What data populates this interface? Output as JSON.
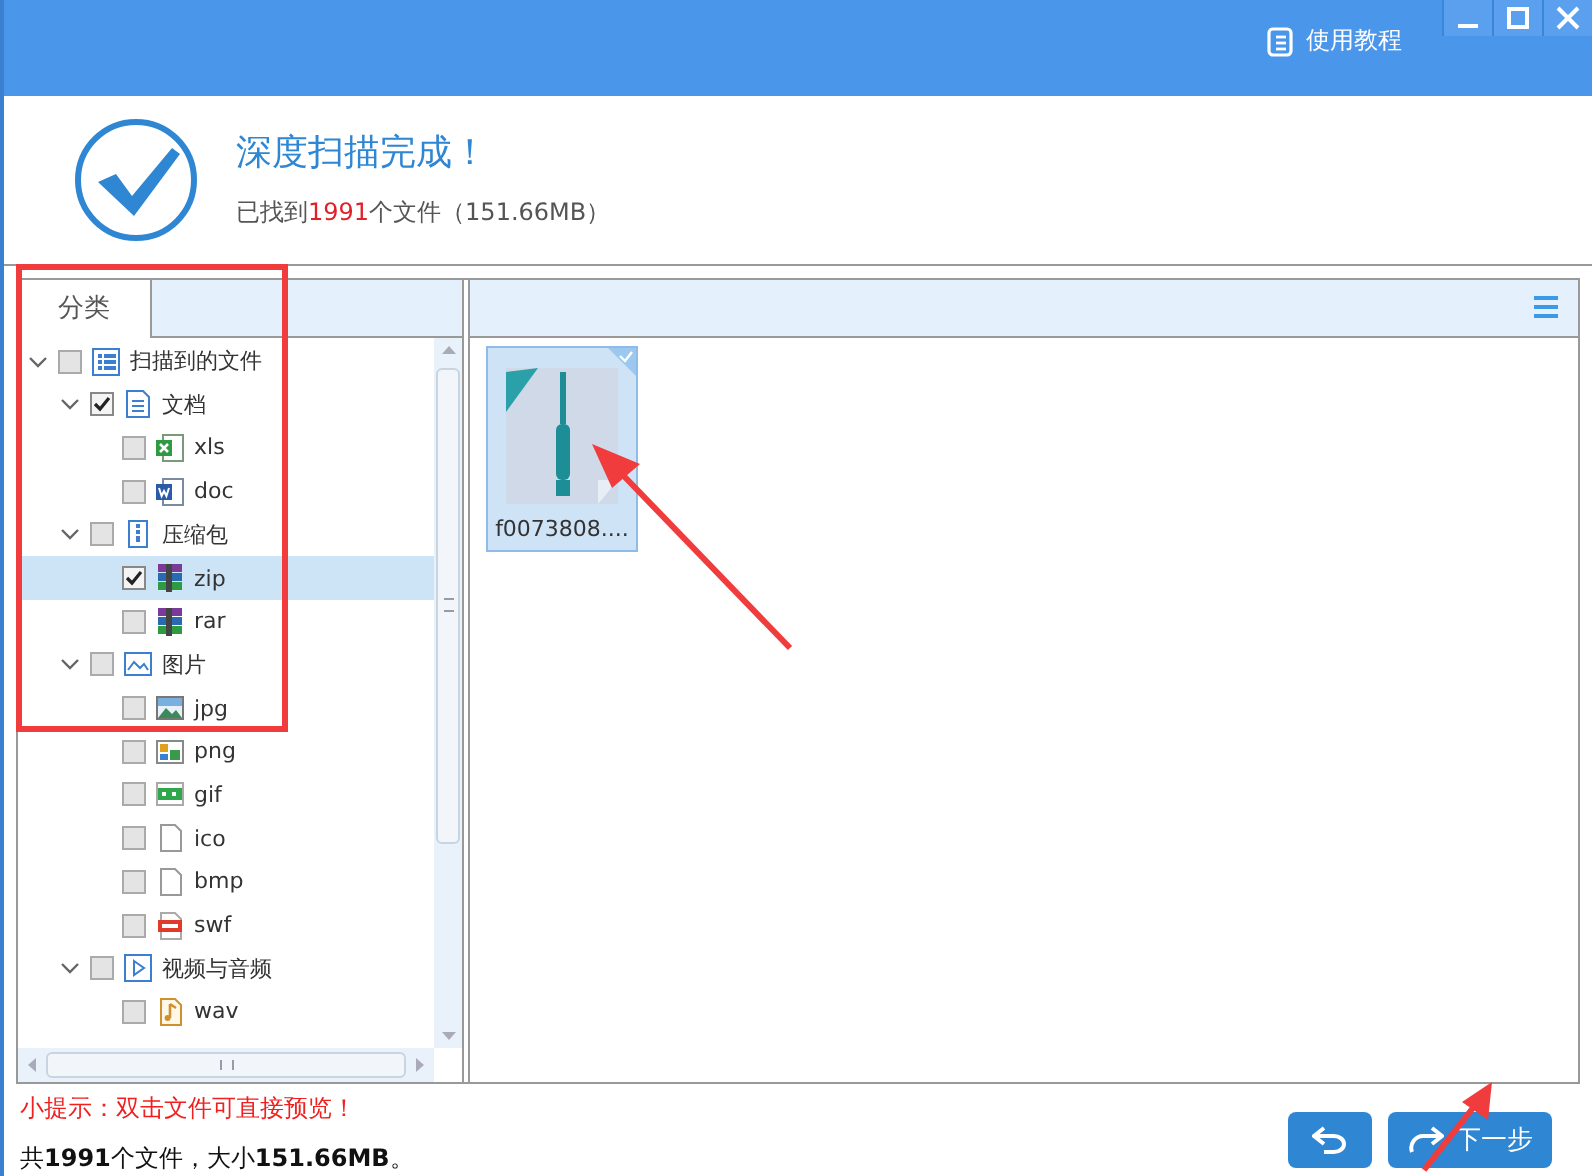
{
  "title_bar": {
    "help_button": "使用教程"
  },
  "scan_result": {
    "title": "深度扫描完成！",
    "summary_prefix": "已找到",
    "count": "1991",
    "summary_suffix": "个文件（151.66MB）"
  },
  "category_tab": {
    "label": "分类",
    "selected": true
  },
  "tree": [
    {
      "label": "扫描到的文件",
      "kind": "list",
      "checked": false,
      "expanded": true,
      "selected": false,
      "children": [
        {
          "label": "文档",
          "kind": "document",
          "checked": true,
          "expanded": true,
          "selected": false,
          "children": [
            {
              "label": "xls",
              "kind": "spreadsheet",
              "checked": false,
              "selected": false
            },
            {
              "label": "doc",
              "kind": "word",
              "checked": false,
              "selected": false
            }
          ]
        },
        {
          "label": "压缩包",
          "kind": "package",
          "checked": false,
          "expanded": true,
          "selected": false,
          "children": [
            {
              "label": "zip",
              "kind": "archive",
              "checked": true,
              "selected": true
            },
            {
              "label": "rar",
              "kind": "archive",
              "checked": false,
              "selected": false
            }
          ]
        },
        {
          "label": "图片",
          "kind": "image",
          "checked": false,
          "expanded": true,
          "selected": false,
          "children": [
            {
              "label": "jpg",
              "kind": "photo",
              "checked": false,
              "selected": false
            },
            {
              "label": "png",
              "kind": "picture-file",
              "checked": false,
              "selected": false
            },
            {
              "label": "gif",
              "kind": "gif",
              "checked": false,
              "selected": false
            },
            {
              "label": "ico",
              "kind": "blank",
              "checked": false,
              "selected": false
            },
            {
              "label": "bmp",
              "kind": "blank",
              "checked": false,
              "selected": false
            },
            {
              "label": "swf",
              "kind": "flash",
              "checked": false,
              "selected": false
            }
          ]
        },
        {
          "label": "视频与音频",
          "kind": "video",
          "checked": false,
          "expanded": true,
          "selected": false,
          "children": [
            {
              "label": "wav",
              "kind": "audio",
              "checked": false,
              "selected": false
            }
          ]
        }
      ]
    }
  ],
  "files": [
    {
      "name": "f0073808....",
      "selected": true
    }
  ],
  "tip": "小提示：双击文件可直接预览！",
  "total": "共**1991**个文件，大小**151.66MB**。",
  "buttons": [
    {
      "kind": "back"
    },
    {
      "kind": "next",
      "label": "下一步"
    }
  ]
}
